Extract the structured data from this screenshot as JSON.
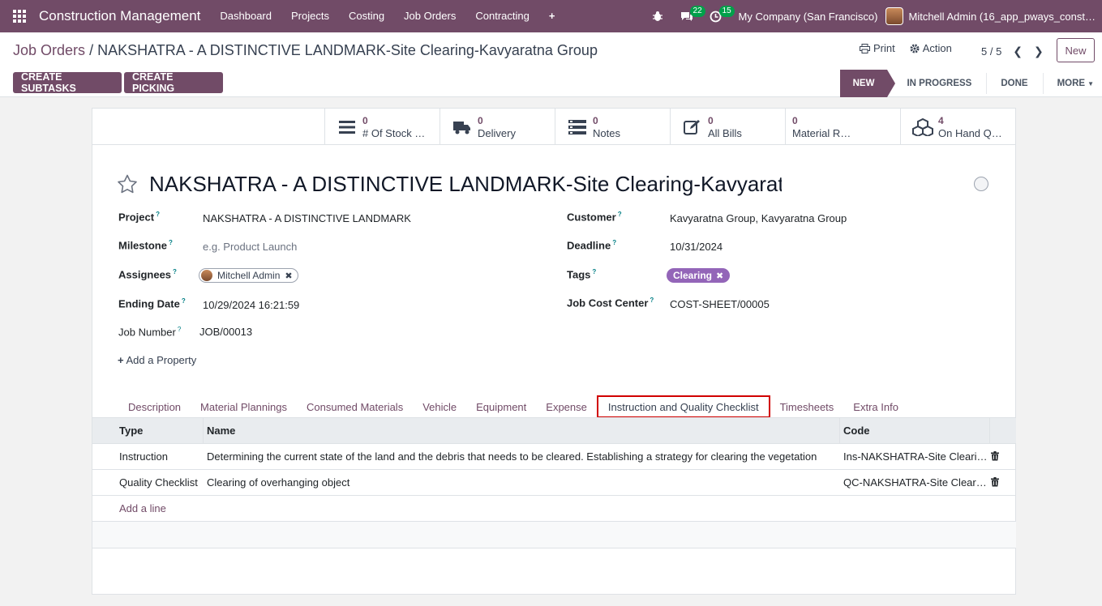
{
  "nav": {
    "app_name": "Construction Management",
    "menu": [
      "Dashboard",
      "Projects",
      "Costing",
      "Job Orders",
      "Contracting"
    ],
    "plus": "+",
    "chat_badge": "22",
    "activity_badge": "15",
    "company": "My Company (San Francisco)",
    "user": "Mitchell Admin (16_app_pways_const…"
  },
  "control": {
    "breadcrumb_parent": "Job Orders",
    "breadcrumb_sep": "/",
    "breadcrumb_current": "NAKSHATRA - A DISTINCTIVE LANDMARK-Site Clearing-Kavyaratna Group",
    "print": "Print",
    "action": "Action",
    "pager": "5 / 5",
    "new": "New",
    "create_subtasks": "CREATE SUBTASKS",
    "create_picking": "CREATE PICKING",
    "stages": [
      "NEW",
      "IN PROGRESS",
      "DONE",
      "MORE"
    ]
  },
  "stats": [
    {
      "num": "0",
      "label": "# Of Stock …",
      "icon": "bars-icon"
    },
    {
      "num": "0",
      "label": "Delivery",
      "icon": "truck-icon"
    },
    {
      "num": "0",
      "label": "Notes",
      "icon": "notes-icon"
    },
    {
      "num": "0",
      "label": "All Bills",
      "icon": "edit-icon"
    },
    {
      "num": "0",
      "label": "Material R…",
      "icon": ""
    },
    {
      "num": "4",
      "label": "On Hand Q…",
      "icon": "cubes-icon"
    }
  ],
  "form": {
    "title": "NAKSHATRA - A DISTINCTIVE LANDMARK-Site Clearing-Kavyaratna Group",
    "project_label": "Project",
    "project": "NAKSHATRA - A DISTINCTIVE LANDMARK",
    "milestone_label": "Milestone",
    "milestone_placeholder": "e.g. Product Launch",
    "assignees_label": "Assignees",
    "assignee": "Mitchell Admin",
    "ending_date_label": "Ending Date",
    "ending_date": "10/29/2024 16:21:59",
    "job_number_label": "Job Number",
    "job_number": "JOB/00013",
    "customer_label": "Customer",
    "customer": "Kavyaratna Group, Kavyaratna Group",
    "deadline_label": "Deadline",
    "deadline": "10/31/2024",
    "tags_label": "Tags",
    "tag": "Clearing",
    "cost_center_label": "Job Cost Center",
    "cost_center": "COST-SHEET/00005",
    "add_property": "Add a Property",
    "help": "?"
  },
  "tabs": [
    "Description",
    "Material Plannings",
    "Consumed Materials",
    "Vehicle",
    "Equipment",
    "Expense",
    "Instruction and Quality Checklist",
    "Timesheets",
    "Extra Info"
  ],
  "list": {
    "headers": [
      "Type",
      "Name",
      "Code"
    ],
    "rows": [
      {
        "type": "Instruction",
        "name": "Determining the current state of the land and the debris that needs to be cleared. Establishing a strategy for clearing the vegetation",
        "code": "Ins-NAKSHATRA-Site Clearing"
      },
      {
        "type": "Quality Checklist",
        "name": "Clearing of overhanging object",
        "code": "QC-NAKSHATRA-Site Clearing"
      }
    ],
    "add_line": "Add a line"
  }
}
